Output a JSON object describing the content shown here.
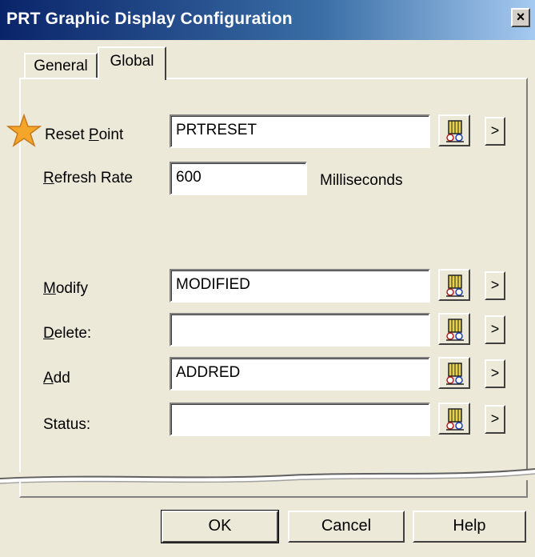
{
  "window": {
    "title": "PRT Graphic Display Configuration",
    "close_glyph": "×"
  },
  "tabs": [
    {
      "label": "General",
      "active": false
    },
    {
      "label": "Global",
      "active": true
    }
  ],
  "fields": {
    "reset_point": {
      "label_pre": "Reset ",
      "label_accel": "P",
      "label_post": "oint",
      "value": "PRTRESET"
    },
    "refresh_rate": {
      "label_accel": "R",
      "label_post": "efresh Rate",
      "value": "600",
      "unit": "Milliseconds"
    },
    "modify": {
      "label_accel": "M",
      "label_post": "odify",
      "value": "MODIFIED"
    },
    "delete": {
      "label_accel": "D",
      "label_post": "elete:",
      "value": ""
    },
    "add": {
      "label_accel": "A",
      "label_post": "dd",
      "value": "ADDRED"
    },
    "status": {
      "label_post": "Status:",
      "value": ""
    }
  },
  "arrow_glyph": ">",
  "icons": {
    "tag_browse": "tag-browser-icon",
    "marker": "star-icon"
  },
  "buttons": {
    "ok": "OK",
    "cancel": "Cancel",
    "help": "Help"
  },
  "colors": {
    "titlebar_start": "#0a246a",
    "titlebar_end": "#a6caf0",
    "star": "#f4a62a"
  }
}
